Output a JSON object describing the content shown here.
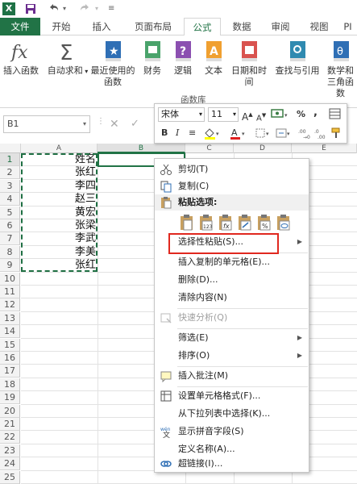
{
  "title_bar": {
    "app_icon": "X",
    "save_icon": "save-icon",
    "undo_icon": "undo-icon",
    "redo_icon": "redo-icon"
  },
  "tabs": [
    {
      "label": "文件",
      "state": "file"
    },
    {
      "label": "开始",
      "state": ""
    },
    {
      "label": "插入",
      "state": ""
    },
    {
      "label": "页面布局",
      "state": ""
    },
    {
      "label": "公式",
      "state": "active"
    },
    {
      "label": "数据",
      "state": ""
    },
    {
      "label": "审阅",
      "state": ""
    },
    {
      "label": "视图",
      "state": ""
    },
    {
      "label": "PI",
      "state": ""
    }
  ],
  "ribbon": {
    "buttons": [
      {
        "label": "插入函数",
        "icon": "fx-icon"
      },
      {
        "label": "自动求和",
        "icon": "sigma-icon"
      },
      {
        "label": "最近使用的函数",
        "icon": "star-book-icon"
      },
      {
        "label": "财务",
        "icon": "finance-book-icon"
      },
      {
        "label": "逻辑",
        "icon": "logic-book-icon"
      },
      {
        "label": "文本",
        "icon": "text-book-icon"
      },
      {
        "label": "日期和时间",
        "icon": "date-book-icon"
      },
      {
        "label": "查找与引用",
        "icon": "lookup-book-icon"
      },
      {
        "label": "数学和三角函数",
        "icon": "math-book-icon"
      }
    ],
    "group_label": "函数库"
  },
  "formula_bar": {
    "name_box": "B1"
  },
  "columns": [
    "A",
    "B",
    "C",
    "D",
    "E"
  ],
  "rows": [
    "1",
    "2",
    "3",
    "4",
    "5",
    "6",
    "7",
    "8",
    "9",
    "10",
    "11",
    "12",
    "13",
    "14",
    "15",
    "16",
    "17",
    "18",
    "19",
    "20",
    "21",
    "22",
    "23",
    "24",
    "25"
  ],
  "cells_a": [
    "姓名",
    "张红",
    "李四",
    "赵三",
    "黄宏",
    "张梁",
    "李武",
    "李美",
    "张红"
  ],
  "mini_toolbar": {
    "font": "宋体",
    "size": "11",
    "bold": "B",
    "italic": "I",
    "percent": "%",
    "comma": ","
  },
  "context_menu": {
    "cut": "剪切(T)",
    "copy": "复制(C)",
    "paste_options": "粘贴选项:",
    "paste_special": "选择性粘贴(S)...",
    "insert_copied": "插入复制的单元格(E)...",
    "delete": "删除(D)...",
    "clear": "清除内容(N)",
    "quick_analysis": "快速分析(Q)",
    "filter": "筛选(E)",
    "sort": "排序(O)",
    "insert_comment": "插入批注(M)",
    "format_cells": "设置单元格格式(F)...",
    "pick_list": "从下拉列表中选择(K)...",
    "phonetic": "显示拼音字段(S)",
    "define_name": "定义名称(A)...",
    "hyperlink": "超链接(I)..."
  },
  "colors": {
    "accent": "#217346",
    "highlight": "#e0281f"
  }
}
